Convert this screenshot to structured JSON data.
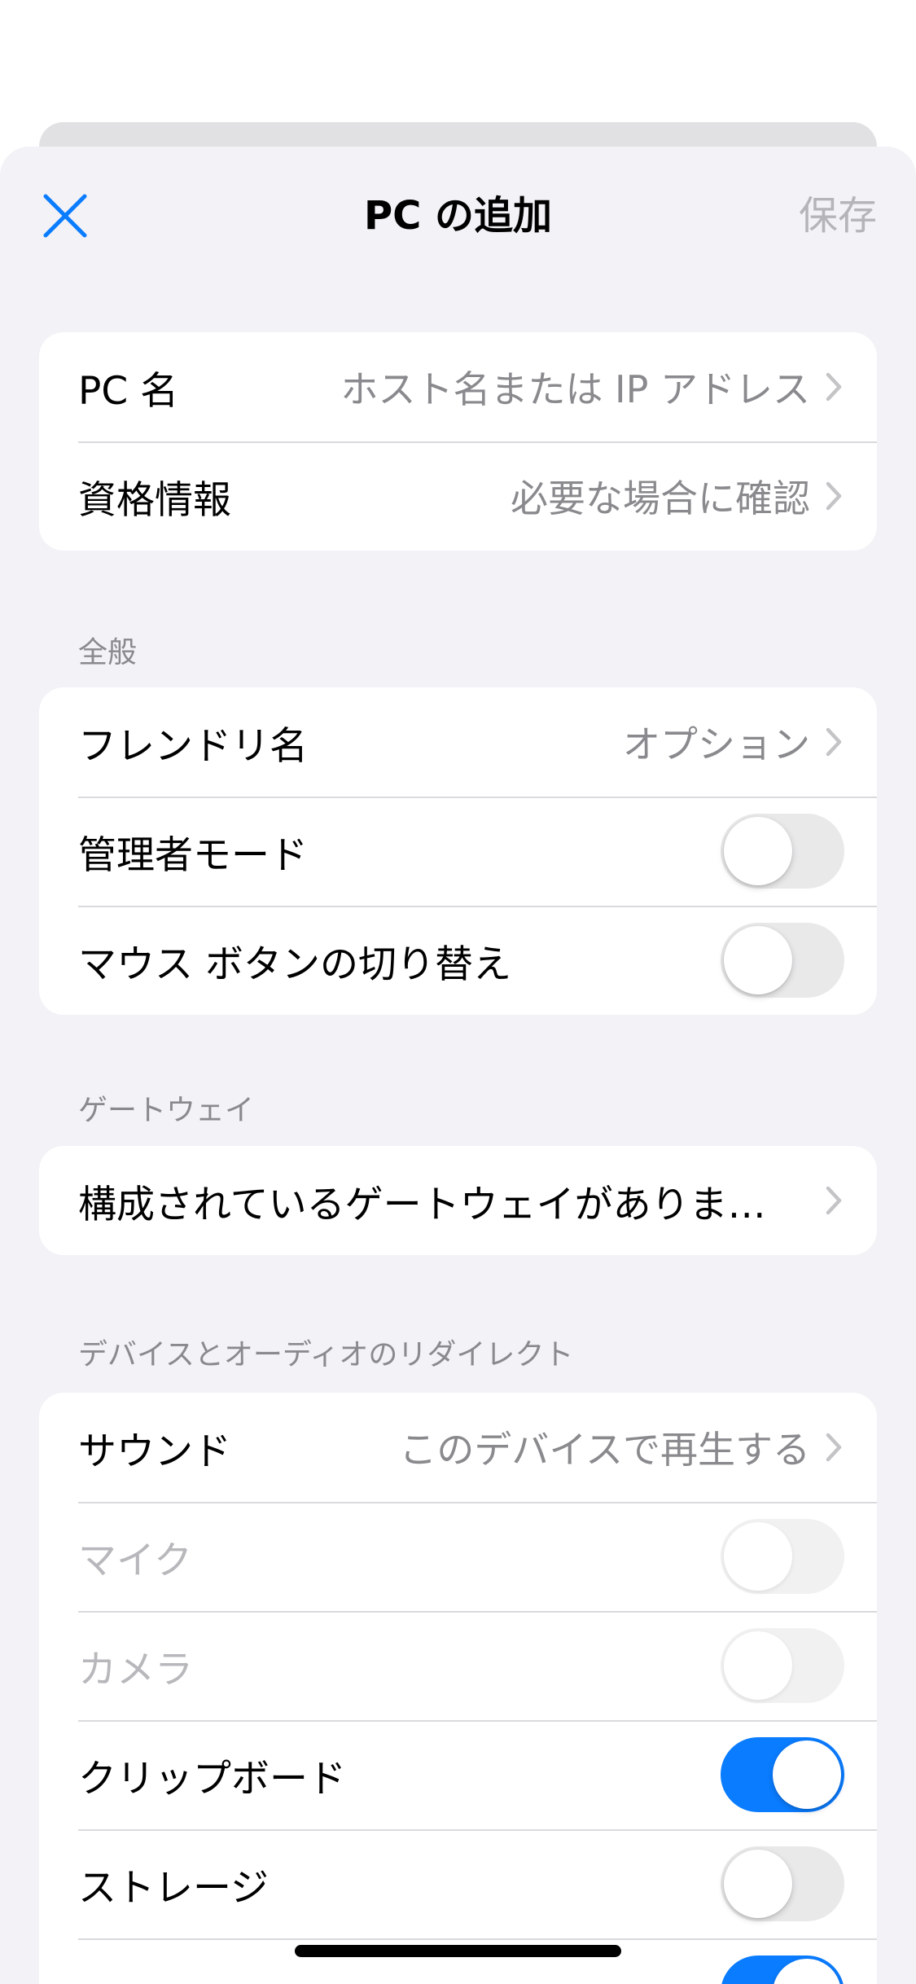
{
  "nav": {
    "title": "PC の追加",
    "save_label": "保存"
  },
  "connection": {
    "pc_name_label": "PC 名",
    "pc_name_placeholder": "ホスト名または IP アドレス",
    "credentials_label": "資格情報",
    "credentials_value": "必要な場合に確認"
  },
  "general": {
    "header": "全般",
    "friendly_name_label": "フレンドリ名",
    "friendly_name_value": "オプション",
    "admin_mode_label": "管理者モード",
    "admin_mode_on": false,
    "swap_mouse_label": "マウス ボタンの切り替え",
    "swap_mouse_on": false
  },
  "gateway": {
    "header": "ゲートウェイ",
    "value": "構成されているゲートウェイがありま…"
  },
  "redirection": {
    "header": "デバイスとオーディオのリダイレクト",
    "sound_label": "サウンド",
    "sound_value": "このデバイスで再生する",
    "mic_label": "マイク",
    "mic_on": false,
    "camera_label": "カメラ",
    "camera_on": false,
    "clipboard_label": "クリップボード",
    "clipboard_on": true,
    "storage_label": "ストレージ",
    "storage_on": false,
    "next_on": true
  },
  "colors": {
    "accent": "#0A7CFF",
    "background": "#F2F2F7",
    "secondary_text": "#8A8A8E"
  }
}
